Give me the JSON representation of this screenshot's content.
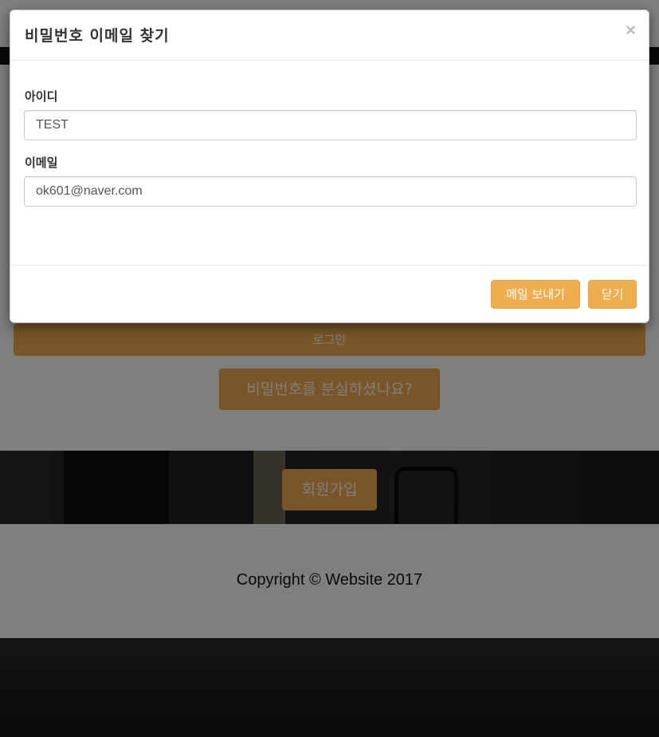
{
  "background": {
    "login_button": "로그인",
    "forgot_button": "비밀번호를 분실하셨나요?",
    "signup_button": "회원가입",
    "footer_text": "Copyright © Website 2017"
  },
  "modal": {
    "title": "비밀번호 이메일 찾기",
    "close_symbol": "×",
    "id_label": "아이디",
    "id_value": "TEST",
    "email_label": "이메일",
    "email_value": "ok601@naver.com",
    "send_button": "메일 보내기",
    "close_button": "닫기"
  },
  "colors": {
    "accent": "#f0ad4e",
    "backdrop": "rgba(0,0,0,0.5)"
  }
}
